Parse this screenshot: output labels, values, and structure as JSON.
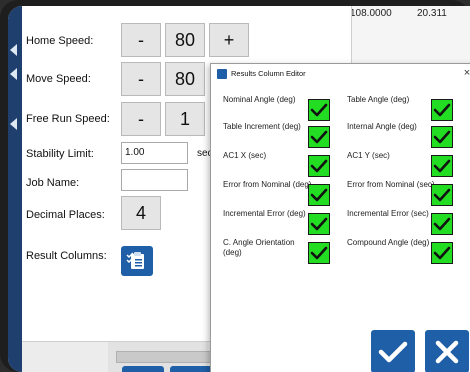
{
  "background_table": {
    "col1": "108.0000",
    "col2": "20.311"
  },
  "settings": {
    "home_speed": {
      "label": "Home Speed:",
      "minus": "-",
      "value": "80",
      "plus": "+"
    },
    "move_speed": {
      "label": "Move Speed:",
      "minus": "-",
      "value": "80"
    },
    "free_run_speed": {
      "label": "Free Run Speed:",
      "minus": "-",
      "value": "1"
    },
    "stability_limit": {
      "label": "Stability Limit:",
      "value": "1.00",
      "unit": "sec"
    },
    "job_name": {
      "label": "Job Name:",
      "value": ""
    },
    "decimal_places": {
      "label": "Decimal Places:",
      "value": "4"
    },
    "result_columns": {
      "label": "Result Columns:",
      "icon": "checklist-icon"
    }
  },
  "dialog": {
    "title": "Results Column Editor",
    "close_glyph": "×",
    "options": [
      {
        "label": "Nominal Angle (deg)",
        "checked": true
      },
      {
        "label": "Table Angle (deg)",
        "checked": true
      },
      {
        "label": "Table Increment (deg)",
        "checked": true
      },
      {
        "label": "Internal Angle (deg)",
        "checked": true
      },
      {
        "label": "AC1 X (sec)",
        "checked": true
      },
      {
        "label": "AC1 Y (sec)",
        "checked": true
      },
      {
        "label": "Error from Nominal (deg)",
        "checked": true
      },
      {
        "label": "Error from Nominal (sec)",
        "checked": true
      },
      {
        "label": "Incremental Error (deg)",
        "checked": true
      },
      {
        "label": "Incremental Error (sec)",
        "checked": true
      },
      {
        "label": "C. Angle Orientation (deg)",
        "checked": true
      },
      {
        "label": "Compound Angle (deg)",
        "checked": true
      }
    ],
    "ok_icon": "checkmark-icon",
    "cancel_icon": "x-icon"
  },
  "colors": {
    "accent_blue": "#1f5fa8",
    "check_green": "#22dd22"
  }
}
